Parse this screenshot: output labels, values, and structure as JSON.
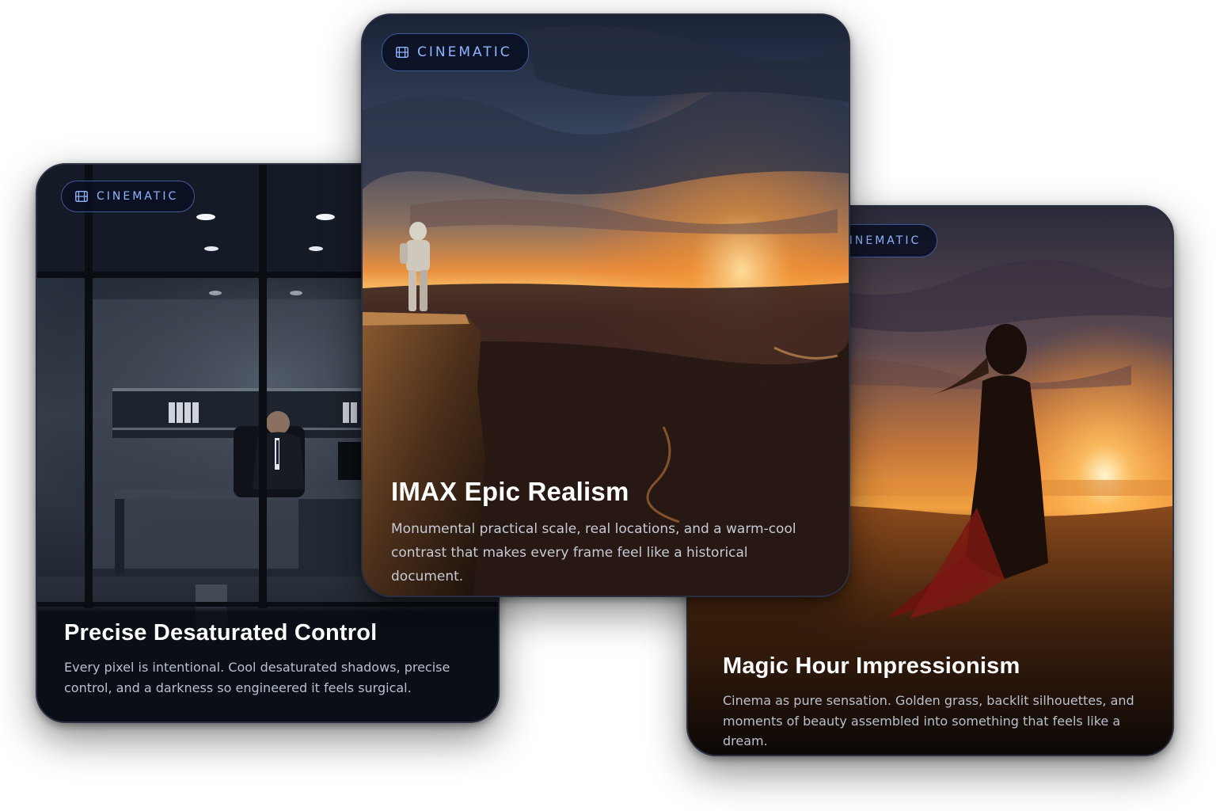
{
  "cards": [
    {
      "badge": "CINEMATIC",
      "badge_icon": "film-icon",
      "title": "Precise Desaturated Control",
      "description": "Every pixel is intentional. Cool desaturated shadows, precise control, and a darkness so engineered it feels surgical."
    },
    {
      "badge": "CINEMATIC",
      "badge_icon": "film-icon",
      "title": "IMAX Epic Realism",
      "description": "Monumental practical scale, real locations, and a warm-cool contrast that makes every frame feel like a historical document."
    },
    {
      "badge": "CINEMATIC",
      "badge_icon": "film-icon",
      "title": "Magic Hour Impressionism",
      "description": "Cinema as pure sensation. Golden grass, backlit silhouettes, and moments of beauty assembled into something that feels like a dream."
    }
  ],
  "colors": {
    "badge_text": "#8fb5ff",
    "badge_border": "#3a5a9a",
    "card_bg": "#0b0e14"
  }
}
